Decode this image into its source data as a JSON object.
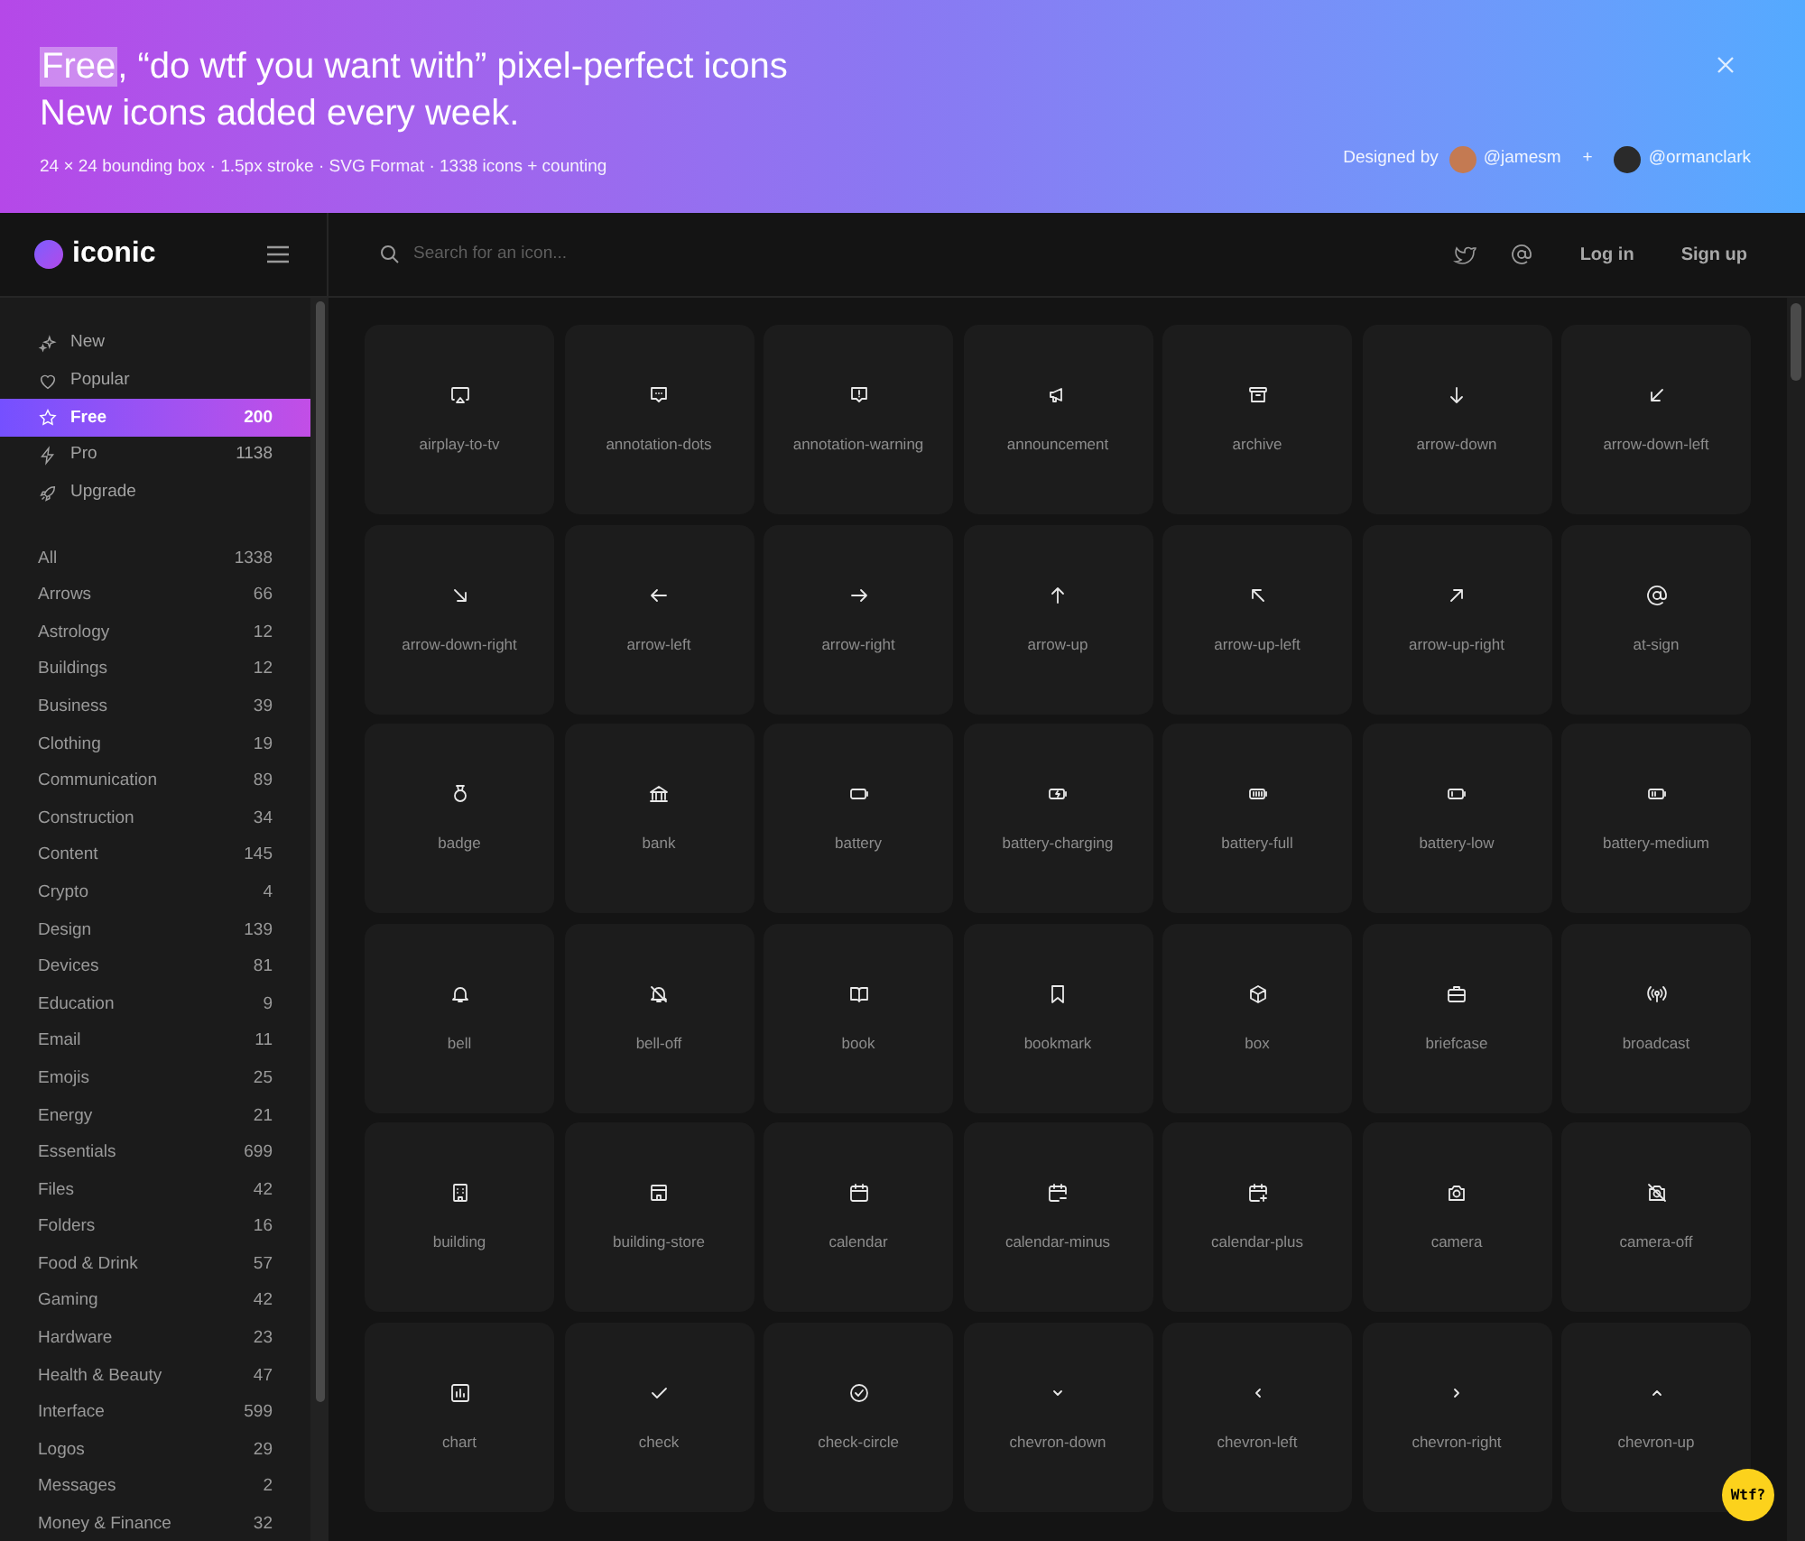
{
  "banner": {
    "headline_highlight": "Free",
    "headline_rest": ", “do wtf you want with” pixel-perfect icons",
    "subheadline": "New icons added every week.",
    "specs": "24 × 24 bounding box · 1.5px stroke · SVG Format · 1338 icons + counting",
    "designed_by_label": "Designed by",
    "designers": [
      {
        "handle": "@jamesm"
      },
      {
        "handle": "@ormanclark"
      }
    ],
    "separator": "+"
  },
  "nav": {
    "logo": "iconic",
    "search": {
      "placeholder": "Search for an icon..."
    },
    "links": [
      "Log in",
      "Sign up"
    ]
  },
  "sidebar": {
    "primary": [
      {
        "kind": "new",
        "label": "New",
        "selected": false
      },
      {
        "kind": "popular",
        "label": "Popular",
        "selected": false
      },
      {
        "kind": "free",
        "label": "Free",
        "count": "200",
        "selected": true
      },
      {
        "kind": "pro",
        "label": "Pro",
        "count": "1138",
        "selected": false
      },
      {
        "kind": "upgrade",
        "label": "Upgrade",
        "selected": false
      }
    ],
    "categories": [
      {
        "label": "All",
        "count": "1338"
      },
      {
        "label": "Arrows",
        "count": "66"
      },
      {
        "label": "Astrology",
        "count": "12"
      },
      {
        "label": "Buildings",
        "count": "12"
      },
      {
        "label": "Business",
        "count": "39"
      },
      {
        "label": "Clothing",
        "count": "19"
      },
      {
        "label": "Communication",
        "count": "89"
      },
      {
        "label": "Construction",
        "count": "34"
      },
      {
        "label": "Content",
        "count": "145"
      },
      {
        "label": "Crypto",
        "count": "4"
      },
      {
        "label": "Design",
        "count": "139"
      },
      {
        "label": "Devices",
        "count": "81"
      },
      {
        "label": "Education",
        "count": "9"
      },
      {
        "label": "Email",
        "count": "11"
      },
      {
        "label": "Emojis",
        "count": "25"
      },
      {
        "label": "Energy",
        "count": "21"
      },
      {
        "label": "Essentials",
        "count": "699"
      },
      {
        "label": "Files",
        "count": "42"
      },
      {
        "label": "Folders",
        "count": "16"
      },
      {
        "label": "Food & Drink",
        "count": "57"
      },
      {
        "label": "Gaming",
        "count": "42"
      },
      {
        "label": "Hardware",
        "count": "23"
      },
      {
        "label": "Health & Beauty",
        "count": "47"
      },
      {
        "label": "Interface",
        "count": "599"
      },
      {
        "label": "Logos",
        "count": "29"
      },
      {
        "label": "Messages",
        "count": "2"
      },
      {
        "label": "Money & Finance",
        "count": "32"
      }
    ]
  },
  "icons": [
    "airplay-to-tv",
    "annotation-dots",
    "annotation-warning",
    "announcement",
    "archive",
    "arrow-down",
    "arrow-down-left",
    "arrow-down-right",
    "arrow-left",
    "arrow-right",
    "arrow-up",
    "arrow-up-left",
    "arrow-up-right",
    "at-sign",
    "badge",
    "bank",
    "battery",
    "battery-charging",
    "battery-full",
    "battery-low",
    "battery-medium",
    "bell",
    "bell-off",
    "book",
    "bookmark",
    "box",
    "briefcase",
    "broadcast",
    "building",
    "building-store",
    "calendar",
    "calendar-minus",
    "calendar-plus",
    "camera",
    "camera-off",
    "chart",
    "check",
    "check-circle",
    "chevron-down",
    "chevron-left",
    "chevron-right",
    "chevron-up"
  ],
  "help_button": "Wtf?"
}
